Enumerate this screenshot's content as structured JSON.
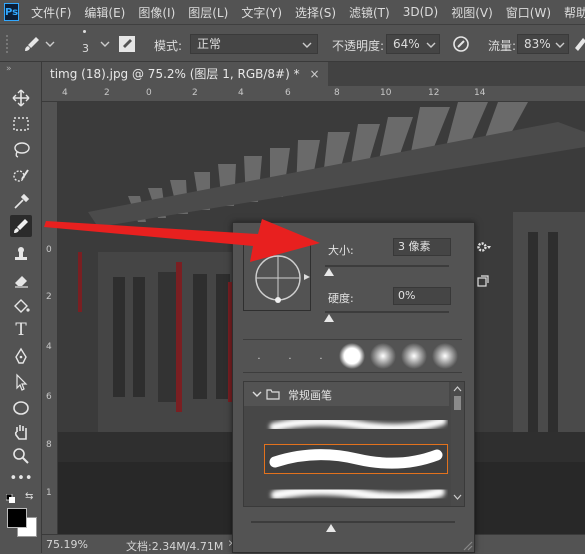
{
  "menu": {
    "logo": "Ps",
    "items": [
      "文件(F)",
      "编辑(E)",
      "图像(I)",
      "图层(L)",
      "文字(Y)",
      "选择(S)",
      "滤镜(T)",
      "3D(D)",
      "视图(V)",
      "窗口(W)",
      "帮助"
    ]
  },
  "options": {
    "brush_size": "3",
    "mode_label": "模式:",
    "mode_value": "正常",
    "opacity_label": "不透明度:",
    "opacity_value": "64%",
    "flow_label": "流量:",
    "flow_value": "83%"
  },
  "document": {
    "tab_title": "timg (18).jpg @ 75.2% (图层 1, RGB/8#) *",
    "close_symbol": "×",
    "ruler_h_ticks": [
      "4",
      "2",
      "0",
      "2",
      "4",
      "6",
      "8",
      "10",
      "12",
      "14"
    ],
    "ruler_v_ticks": [
      "0",
      "2",
      "4",
      "6",
      "8",
      "1"
    ],
    "zoom": "75.19%",
    "doc_info": "文档:2.34M/4.71M",
    "status_arrow": "›"
  },
  "brush_popup": {
    "size_label": "大小:",
    "size_value": "3 像素",
    "hardness_label": "硬度:",
    "hardness_value": "0%",
    "size_slider_fraction": 0.0,
    "hardness_slider_fraction": 0.0,
    "preset_tips": [
      ".",
      ".",
      ".",
      "",
      "",
      "",
      ""
    ],
    "folder_name": "常规画笔",
    "settings_icon": "gear-icon"
  },
  "colors": {
    "ui_bg": "#535353",
    "canvas_bg": "#3a3a3a",
    "arrow": "#e8201f",
    "selection_border": "#e3721d"
  }
}
